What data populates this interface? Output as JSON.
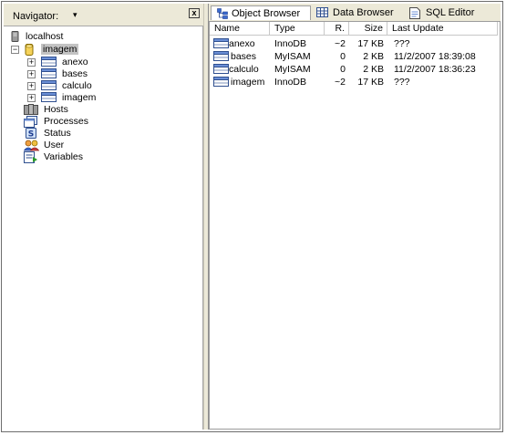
{
  "navigator": {
    "title": "Navigator:",
    "dropdown_glyph": "▾",
    "close_glyph": "x",
    "server": {
      "label": "localhost",
      "icon": "server-icon"
    },
    "database": {
      "label": "imagem",
      "icon": "database-icon",
      "expander": "−"
    },
    "tables": [
      {
        "label": "anexo",
        "expander": "+"
      },
      {
        "label": "bases",
        "expander": "+"
      },
      {
        "label": "calculo",
        "expander": "+"
      },
      {
        "label": "imagem",
        "expander": "+"
      }
    ],
    "items": [
      {
        "label": "Hosts",
        "icon": "hosts-icon"
      },
      {
        "label": "Processes",
        "icon": "processes-icon"
      },
      {
        "label": "Status",
        "icon": "status-icon"
      },
      {
        "label": "User",
        "icon": "users-icon"
      },
      {
        "label": "Variables",
        "icon": "variables-icon"
      }
    ]
  },
  "tabs": [
    {
      "label": "Object Browser",
      "icon": "object-browser-icon",
      "active": true
    },
    {
      "label": "Data Browser",
      "icon": "data-browser-icon",
      "active": false
    },
    {
      "label": "SQL Editor",
      "icon": "sql-editor-icon",
      "active": false
    }
  ],
  "table": {
    "columns": [
      "Name",
      "Type",
      "R.",
      "Size",
      "Last Update"
    ],
    "rows": [
      {
        "name": "anexo",
        "type": "InnoDB",
        "rows": "~2",
        "size": "17 KB",
        "updated": "???"
      },
      {
        "name": "bases",
        "type": "MyISAM",
        "rows": "0",
        "size": "2 KB",
        "updated": "11/2/2007 18:39:08"
      },
      {
        "name": "calculo",
        "type": "MyISAM",
        "rows": "0",
        "size": "2 KB",
        "updated": "11/2/2007 18:36:23"
      },
      {
        "name": "imagem",
        "type": "InnoDB",
        "rows": "~2",
        "size": "17 KB",
        "updated": "???"
      }
    ]
  },
  "colors": {
    "panel_bg": "#ece9d8",
    "selection": "#c3c3c3"
  }
}
